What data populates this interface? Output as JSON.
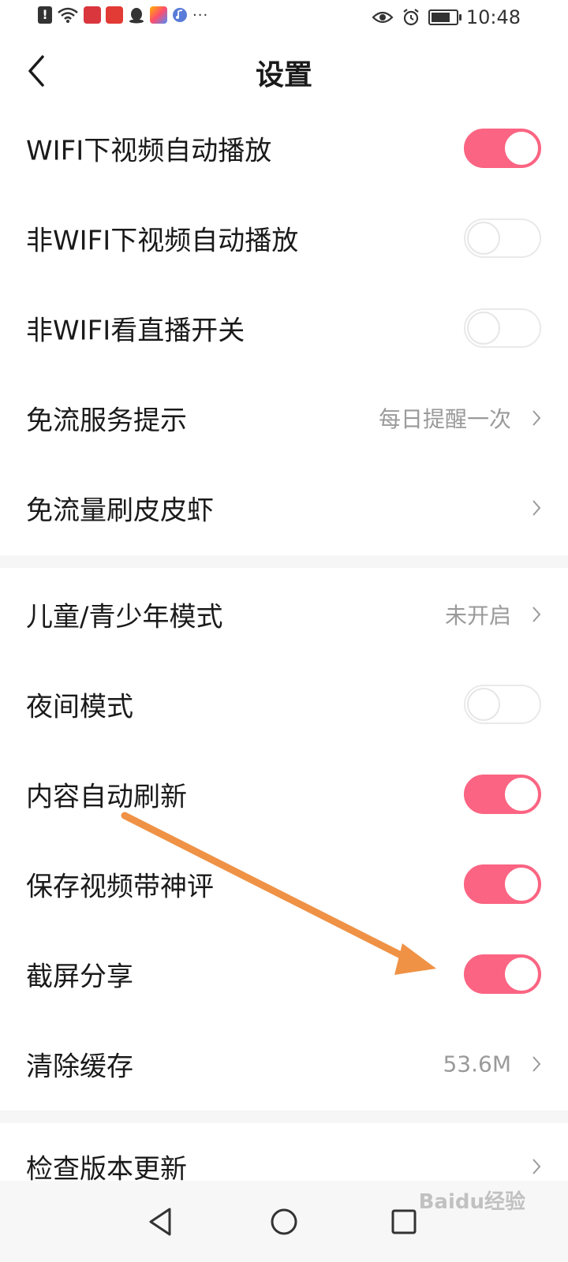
{
  "status_bar": {
    "time": "10:48",
    "left_icons": [
      "alert-icon",
      "wifi-icon",
      "book-app-icon",
      "shop-app-icon",
      "qq-icon",
      "multicolor-app-icon",
      "music-app-icon"
    ],
    "more": "···",
    "right_icons": [
      "eye-icon",
      "alarm-icon",
      "battery-icon"
    ],
    "battery_level": 0.9
  },
  "header": {
    "title": "设置"
  },
  "colors": {
    "accent": "#fb6482",
    "divider": "#f6f6f6",
    "secondary_text": "#9a9a9a",
    "annotation_arrow": "#ef9245"
  },
  "settings": {
    "section1": [
      {
        "label": "WIFI下视频自动播放",
        "type": "toggle",
        "on": true
      },
      {
        "label": "非WIFI下视频自动播放",
        "type": "toggle",
        "on": false
      },
      {
        "label": "非WIFI看直播开关",
        "type": "toggle",
        "on": false
      },
      {
        "label": "免流服务提示",
        "type": "link",
        "value": "每日提醒一次"
      },
      {
        "label": "免流量刷皮皮虾",
        "type": "link",
        "value": ""
      }
    ],
    "section2": [
      {
        "label": "儿童/青少年模式",
        "type": "link",
        "value": "未开启"
      },
      {
        "label": "夜间模式",
        "type": "toggle",
        "on": false
      },
      {
        "label": "内容自动刷新",
        "type": "toggle",
        "on": true
      },
      {
        "label": "保存视频带神评",
        "type": "toggle",
        "on": true
      },
      {
        "label": "截屏分享",
        "type": "toggle",
        "on": true
      },
      {
        "label": "清除缓存",
        "type": "link",
        "value": "53.6M"
      }
    ],
    "section3": [
      {
        "label": "检查版本更新",
        "type": "link",
        "value": ""
      }
    ]
  },
  "watermark": "Baidu经验"
}
